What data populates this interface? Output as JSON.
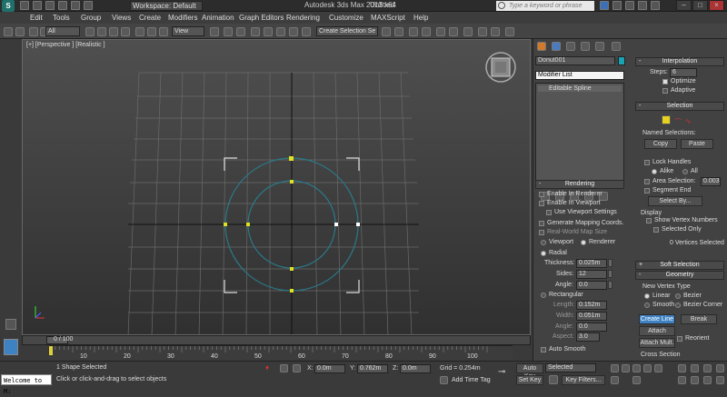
{
  "titlebar": {
    "workspace_label": "Workspace: Default",
    "app_title": "Autodesk 3ds Max  2013 x64",
    "doc_title": "Untitled",
    "search_placeholder": "Type a keyword or phrase"
  },
  "menu": [
    "Edit",
    "Tools",
    "Group",
    "Views",
    "Create",
    "Modifiers",
    "Animation",
    "Graph Editors",
    "Rendering",
    "Customize",
    "MAXScript",
    "Help"
  ],
  "toolbar": {
    "filter_select": "All",
    "view_select": "View",
    "selection_set": "Create Selection Se"
  },
  "viewport": {
    "label": "[+] [Perspective ] [Realistic ]",
    "spline_color": "#2a7a8a",
    "vertex_color": "#e0e020"
  },
  "command_panel": {
    "object_name": "Donut001",
    "modifier_list": "Modifier List",
    "stack_item": "Editable Spline",
    "rendering": {
      "header": "Rendering",
      "enable_renderer": "Enable In Renderer",
      "enable_viewport": "Enable In Viewport",
      "use_viewport_settings": "Use Viewport Settings",
      "gen_mapping": "Generate Mapping Coords.",
      "real_world": "Real-World Map Size",
      "viewport_opt": "Viewport",
      "renderer_opt": "Renderer",
      "radial": "Radial",
      "thickness_label": "Thickness:",
      "thickness": "0.025m",
      "sides_label": "Sides:",
      "sides": "12",
      "angle_label": "Angle:",
      "angle": "0.0",
      "rectangular": "Rectangular",
      "length_label": "Length:",
      "length": "0.152m",
      "width_label": "Width:",
      "width": "0.051m",
      "angle2_label": "Angle:",
      "angle2": "0.0",
      "aspect_label": "Aspect:",
      "aspect": "3.0",
      "auto_smooth": "Auto Smooth"
    },
    "interpolation": {
      "header": "Interpolation",
      "steps_label": "Steps:",
      "steps": "6",
      "optimize": "Optimize",
      "adaptive": "Adaptive"
    },
    "selection": {
      "header": "Selection",
      "named_selections": "Named Selections:",
      "copy": "Copy",
      "paste": "Paste",
      "lock_handles": "Lock Handles",
      "alike": "Alike",
      "all": "All",
      "area_selection": "Area Selection:",
      "area_value": "0.003",
      "segment_end": "Segment End",
      "select_by": "Select By...",
      "display": "Display",
      "show_vertex_numbers": "Show Vertex Numbers",
      "selected_only": "Selected Only",
      "status": "0 Vertices Selected"
    },
    "soft_selection": {
      "header": "Soft Selection"
    },
    "geometry": {
      "header": "Geometry",
      "new_vertex_type": "New Vertex Type",
      "linear": "Linear",
      "bezier": "Bezier",
      "smooth": "Smooth",
      "bezier_corner": "Bezier Corner",
      "create_line": "Create Line",
      "break": "Break",
      "attach": "Attach",
      "reorient": "Reorient",
      "attach_mult": "Attach Mult.",
      "cross_section": "Cross Section"
    }
  },
  "timeline": {
    "frame_label": "0 / 100",
    "ticks": [
      "0",
      "10",
      "20",
      "30",
      "40",
      "50",
      "60",
      "70",
      "80",
      "90",
      "100"
    ]
  },
  "status": {
    "welcome": "Welcome to M:",
    "shapes_selected": "1 Shape Selected",
    "prompt": "Click or click-and-drag to select objects",
    "x_label": "X:",
    "x_value": "0.0m",
    "y_label": "Y:",
    "y_value": "0.762m",
    "z_label": "Z:",
    "z_value": "0.0m",
    "grid": "Grid = 0.254m",
    "auto_key": "Auto Key",
    "selected": "Selected",
    "set_key": "Set Key",
    "key_filters": "Key Filters...",
    "add_time_tag": "Add Time Tag"
  }
}
